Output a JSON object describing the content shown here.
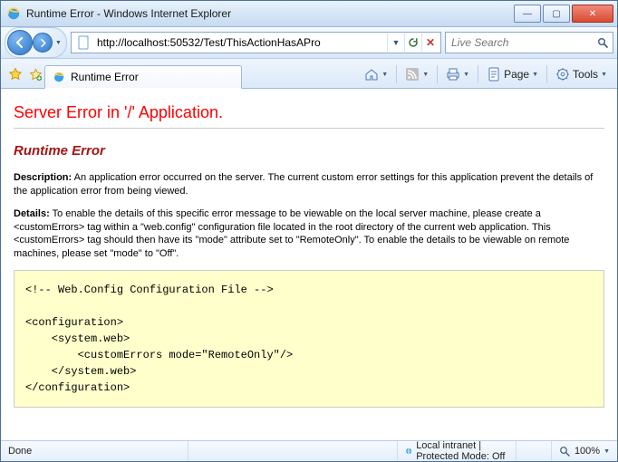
{
  "window": {
    "title": "Runtime Error - Windows Internet Explorer"
  },
  "address": {
    "url": "http://localhost:50532/Test/ThisActionHasAPro"
  },
  "search": {
    "placeholder": "Live Search"
  },
  "tab": {
    "label": "Runtime Error"
  },
  "toolbar": {
    "page_label": "Page",
    "tools_label": "Tools"
  },
  "page": {
    "h1": "Server Error in '/' Application.",
    "h2": "Runtime Error",
    "desc_label": "Description:",
    "desc_text": " An application error occurred on the server. The current custom error settings for this application prevent the details of the application error from being viewed.",
    "details_label": "Details:",
    "details_text": " To enable the details of this specific error message to be viewable on the local server machine, please create a <customErrors> tag within a \"web.config\" configuration file located in the root directory of the current web application. This <customErrors> tag should then have its \"mode\" attribute set to \"RemoteOnly\". To enable the details to be viewable on remote machines, please set \"mode\" to \"Off\".",
    "code": "<!-- Web.Config Configuration File -->\n\n<configuration>\n    <system.web>\n        <customErrors mode=\"RemoteOnly\"/>\n    </system.web>\n</configuration>"
  },
  "status": {
    "done": "Done",
    "zone": "Local intranet | Protected Mode: Off",
    "zoom": "100%"
  }
}
